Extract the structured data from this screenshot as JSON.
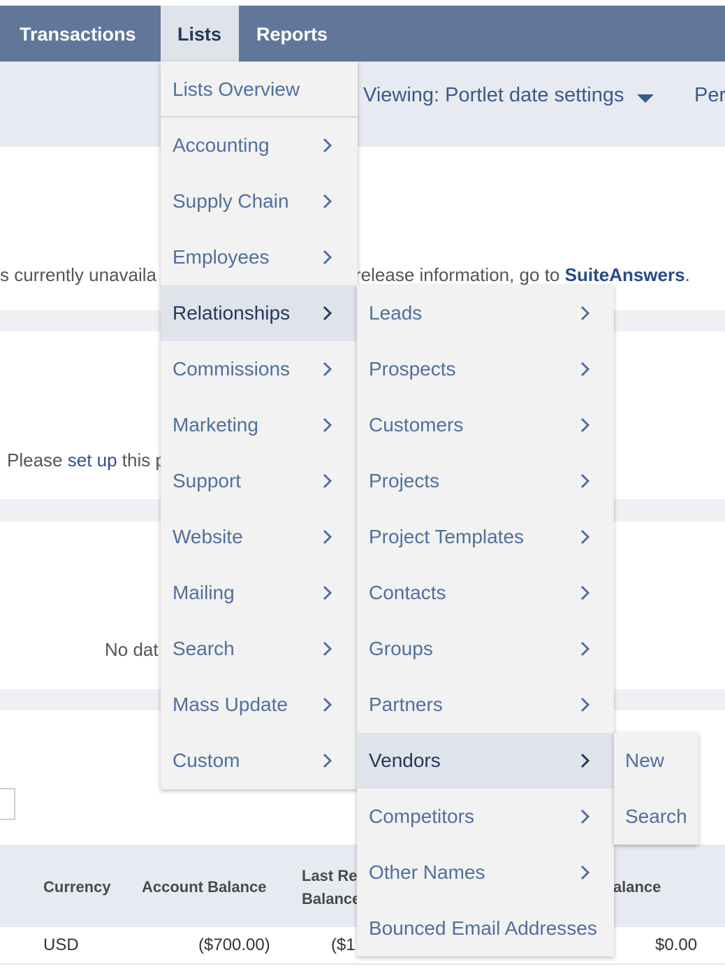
{
  "nav": {
    "tabs": [
      {
        "label": "Transactions"
      },
      {
        "label": "Lists",
        "active": true
      },
      {
        "label": "Reports"
      }
    ]
  },
  "header": {
    "viewing_label": "Viewing: Portlet date settings",
    "right_text": "Per"
  },
  "background": {
    "unavailable_text": "s currently unavaila",
    "release_text": "release information, go to ",
    "suiteanswers_link": "SuiteAnswers",
    "release_suffix": ".",
    "please_prefix": "Please ",
    "setup_link": "set up",
    "please_suffix": " this p",
    "no_data_text": "No dat"
  },
  "table": {
    "headers": [
      "Currency",
      "Account Balance",
      "Last Re",
      "Balance",
      "Balance"
    ],
    "row": [
      "USD",
      "($700.00)",
      "($1,",
      "$0.00"
    ]
  },
  "lists_menu": {
    "items": [
      {
        "label": "Lists Overview",
        "submenu": false
      },
      {
        "label": "Accounting",
        "submenu": true
      },
      {
        "label": "Supply Chain",
        "submenu": true
      },
      {
        "label": "Employees",
        "submenu": true
      },
      {
        "label": "Relationships",
        "submenu": true,
        "active": true
      },
      {
        "label": "Commissions",
        "submenu": true
      },
      {
        "label": "Marketing",
        "submenu": true
      },
      {
        "label": "Support",
        "submenu": true
      },
      {
        "label": "Website",
        "submenu": true
      },
      {
        "label": "Mailing",
        "submenu": true
      },
      {
        "label": "Search",
        "submenu": true
      },
      {
        "label": "Mass Update",
        "submenu": true
      },
      {
        "label": "Custom",
        "submenu": true
      }
    ]
  },
  "relationships_menu": {
    "items": [
      {
        "label": "Leads",
        "submenu": true
      },
      {
        "label": "Prospects",
        "submenu": true
      },
      {
        "label": "Customers",
        "submenu": true
      },
      {
        "label": "Projects",
        "submenu": true
      },
      {
        "label": "Project Templates",
        "submenu": true
      },
      {
        "label": "Contacts",
        "submenu": true
      },
      {
        "label": "Groups",
        "submenu": true
      },
      {
        "label": "Partners",
        "submenu": true
      },
      {
        "label": "Vendors",
        "submenu": true,
        "active": true
      },
      {
        "label": "Competitors",
        "submenu": true
      },
      {
        "label": "Other Names",
        "submenu": true
      },
      {
        "label": "Bounced Email Addresses",
        "submenu": false
      }
    ]
  },
  "vendors_menu": {
    "items": [
      {
        "label": "New"
      },
      {
        "label": "Search"
      }
    ]
  },
  "colors": {
    "nav_bg": "#607799",
    "menu_bg": "#f2f2f2",
    "menu_text": "#50709d",
    "active_bg": "#dfe4eb",
    "active_text": "#27385a"
  }
}
